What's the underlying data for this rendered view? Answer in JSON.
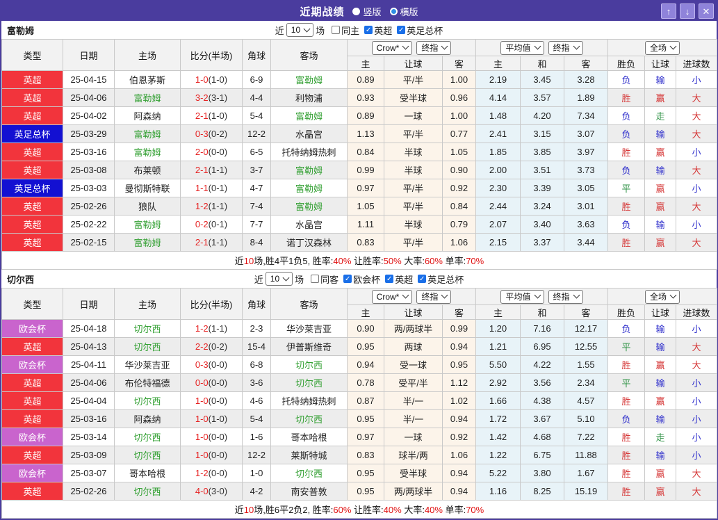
{
  "window": {
    "title": "近期战绩",
    "view_options": [
      {
        "label": "竖版",
        "selected": true
      },
      {
        "label": "横版",
        "selected": false
      }
    ],
    "buttons": [
      {
        "name": "scroll-up",
        "glyph": "↑"
      },
      {
        "name": "scroll-down",
        "glyph": "↓"
      },
      {
        "name": "close",
        "glyph": "✕"
      }
    ]
  },
  "league_colors": {
    "英超": "#f2343c",
    "英足总杯": "#1310d2",
    "欧会杯": "#c964cd"
  },
  "result_colors": {
    "胜": "#d53535",
    "赢": "#d53535",
    "大": "#d53535",
    "负": "#2d2dcb",
    "输": "#2d2dcb",
    "小": "#2d2dcb",
    "平": "#2e9245",
    "走": "#2e9245"
  },
  "table_header": {
    "main": [
      "类型",
      "日期",
      "主场",
      "比分(半场)",
      "角球",
      "客场"
    ],
    "odds_group": {
      "source": "Crow*",
      "index": "终指"
    },
    "avg_group": {
      "source": "平均值",
      "index": "终指"
    },
    "scope_group": {
      "label": "全场"
    },
    "sub": [
      "主",
      "让球",
      "客",
      "主",
      "和",
      "客",
      "胜负",
      "让球",
      "进球数"
    ]
  },
  "sections": [
    {
      "team": "富勒姆",
      "filters": {
        "prefix": "近",
        "count": "10",
        "suffix": "场",
        "checkboxes": [
          {
            "label": "同主",
            "checked": false
          },
          {
            "label": "英超",
            "checked": true
          },
          {
            "label": "英足总杯",
            "checked": true
          }
        ]
      },
      "rows": [
        {
          "league": "英超",
          "date": "25-04-15",
          "home": "伯恩茅斯",
          "score": "1-0",
          "half": "(1-0)",
          "corners": "6-9",
          "away": "富勒姆",
          "home_odds": "0.89",
          "handicap": "平/半",
          "away_odds": "1.00",
          "avg_home": "2.19",
          "avg_draw": "3.45",
          "avg_away": "3.28",
          "result": "负",
          "handicap_result": "输",
          "goals_result": "小"
        },
        {
          "league": "英超",
          "date": "25-04-06",
          "home": "富勒姆",
          "score": "3-2",
          "half": "(3-1)",
          "corners": "4-4",
          "away": "利物浦",
          "home_odds": "0.93",
          "handicap": "受半球",
          "away_odds": "0.96",
          "avg_home": "4.14",
          "avg_draw": "3.57",
          "avg_away": "1.89",
          "result": "胜",
          "handicap_result": "赢",
          "goals_result": "大"
        },
        {
          "league": "英超",
          "date": "25-04-02",
          "home": "阿森纳",
          "score": "2-1",
          "half": "(1-0)",
          "corners": "5-4",
          "away": "富勒姆",
          "home_odds": "0.89",
          "handicap": "一球",
          "away_odds": "1.00",
          "avg_home": "1.48",
          "avg_draw": "4.20",
          "avg_away": "7.34",
          "result": "负",
          "handicap_result": "走",
          "goals_result": "大"
        },
        {
          "league": "英足总杯",
          "date": "25-03-29",
          "home": "富勒姆",
          "score": "0-3",
          "half": "(0-2)",
          "corners": "12-2",
          "away": "水晶宫",
          "home_odds": "1.13",
          "handicap": "平/半",
          "away_odds": "0.77",
          "avg_home": "2.41",
          "avg_draw": "3.15",
          "avg_away": "3.07",
          "result": "负",
          "handicap_result": "输",
          "goals_result": "大"
        },
        {
          "league": "英超",
          "date": "25-03-16",
          "home": "富勒姆",
          "score": "2-0",
          "half": "(0-0)",
          "corners": "6-5",
          "away": "托特纳姆热刺",
          "home_odds": "0.84",
          "handicap": "半球",
          "away_odds": "1.05",
          "avg_home": "1.85",
          "avg_draw": "3.85",
          "avg_away": "3.97",
          "result": "胜",
          "handicap_result": "赢",
          "goals_result": "小"
        },
        {
          "league": "英超",
          "date": "25-03-08",
          "home": "布莱顿",
          "score": "2-1",
          "half": "(1-1)",
          "corners": "3-7",
          "away": "富勒姆",
          "home_odds": "0.99",
          "handicap": "半球",
          "away_odds": "0.90",
          "avg_home": "2.00",
          "avg_draw": "3.51",
          "avg_away": "3.73",
          "result": "负",
          "handicap_result": "输",
          "goals_result": "大"
        },
        {
          "league": "英足总杯",
          "date": "25-03-03",
          "home": "曼彻斯特联",
          "score": "1-1",
          "half": "(0-1)",
          "corners": "4-7",
          "away": "富勒姆",
          "home_odds": "0.97",
          "handicap": "平/半",
          "away_odds": "0.92",
          "avg_home": "2.30",
          "avg_draw": "3.39",
          "avg_away": "3.05",
          "result": "平",
          "handicap_result": "赢",
          "goals_result": "小"
        },
        {
          "league": "英超",
          "date": "25-02-26",
          "home": "狼队",
          "score": "1-2",
          "half": "(1-1)",
          "corners": "7-4",
          "away": "富勒姆",
          "home_odds": "1.05",
          "handicap": "平/半",
          "away_odds": "0.84",
          "avg_home": "2.44",
          "avg_draw": "3.24",
          "avg_away": "3.01",
          "result": "胜",
          "handicap_result": "赢",
          "goals_result": "大"
        },
        {
          "league": "英超",
          "date": "25-02-22",
          "home": "富勒姆",
          "score": "0-2",
          "half": "(0-1)",
          "corners": "7-7",
          "away": "水晶宫",
          "home_odds": "1.11",
          "handicap": "半球",
          "away_odds": "0.79",
          "avg_home": "2.07",
          "avg_draw": "3.40",
          "avg_away": "3.63",
          "result": "负",
          "handicap_result": "输",
          "goals_result": "小"
        },
        {
          "league": "英超",
          "date": "25-02-15",
          "home": "富勒姆",
          "score": "2-1",
          "half": "(1-1)",
          "corners": "8-4",
          "away": "诺丁汉森林",
          "home_odds": "0.83",
          "handicap": "平/半",
          "away_odds": "1.06",
          "avg_home": "2.15",
          "avg_draw": "3.37",
          "avg_away": "3.44",
          "result": "胜",
          "handicap_result": "赢",
          "goals_result": "大"
        }
      ],
      "summary": [
        {
          "text": "近"
        },
        {
          "text": "10",
          "red": true
        },
        {
          "text": "场,胜4平1负5, 胜率:"
        },
        {
          "text": "40%",
          "red": true
        },
        {
          "text": " 让胜率:"
        },
        {
          "text": "50%",
          "red": true
        },
        {
          "text": " 大率:"
        },
        {
          "text": "60%",
          "red": true
        },
        {
          "text": " 单率:"
        },
        {
          "text": "70%",
          "red": true
        }
      ]
    },
    {
      "team": "切尔西",
      "filters": {
        "prefix": "近",
        "count": "10",
        "suffix": "场",
        "checkboxes": [
          {
            "label": "同客",
            "checked": false
          },
          {
            "label": "欧会杯",
            "checked": true
          },
          {
            "label": "英超",
            "checked": true
          },
          {
            "label": "英足总杯",
            "checked": true
          }
        ]
      },
      "rows": [
        {
          "league": "欧会杯",
          "date": "25-04-18",
          "home": "切尔西",
          "score": "1-2",
          "half": "(1-1)",
          "corners": "2-3",
          "away": "华沙莱吉亚",
          "home_odds": "0.90",
          "handicap": "两/两球半",
          "away_odds": "0.99",
          "avg_home": "1.20",
          "avg_draw": "7.16",
          "avg_away": "12.17",
          "result": "负",
          "handicap_result": "输",
          "goals_result": "小"
        },
        {
          "league": "英超",
          "date": "25-04-13",
          "home": "切尔西",
          "score": "2-2",
          "half": "(0-2)",
          "corners": "15-4",
          "away": "伊普斯维奇",
          "home_odds": "0.95",
          "handicap": "两球",
          "away_odds": "0.94",
          "avg_home": "1.21",
          "avg_draw": "6.95",
          "avg_away": "12.55",
          "result": "平",
          "handicap_result": "输",
          "goals_result": "大"
        },
        {
          "league": "欧会杯",
          "date": "25-04-11",
          "home": "华沙莱吉亚",
          "score": "0-3",
          "half": "(0-0)",
          "corners": "6-8",
          "away": "切尔西",
          "home_odds": "0.94",
          "handicap": "受一球",
          "away_odds": "0.95",
          "avg_home": "5.50",
          "avg_draw": "4.22",
          "avg_away": "1.55",
          "result": "胜",
          "handicap_result": "赢",
          "goals_result": "大"
        },
        {
          "league": "英超",
          "date": "25-04-06",
          "home": "布伦特福德",
          "score": "0-0",
          "half": "(0-0)",
          "corners": "3-6",
          "away": "切尔西",
          "home_odds": "0.78",
          "handicap": "受平/半",
          "away_odds": "1.12",
          "avg_home": "2.92",
          "avg_draw": "3.56",
          "avg_away": "2.34",
          "result": "平",
          "handicap_result": "输",
          "goals_result": "小"
        },
        {
          "league": "英超",
          "date": "25-04-04",
          "home": "切尔西",
          "score": "1-0",
          "half": "(0-0)",
          "corners": "4-6",
          "away": "托特纳姆热刺",
          "home_odds": "0.87",
          "handicap": "半/一",
          "away_odds": "1.02",
          "avg_home": "1.66",
          "avg_draw": "4.38",
          "avg_away": "4.57",
          "result": "胜",
          "handicap_result": "赢",
          "goals_result": "小"
        },
        {
          "league": "英超",
          "date": "25-03-16",
          "home": "阿森纳",
          "score": "1-0",
          "half": "(1-0)",
          "corners": "5-4",
          "away": "切尔西",
          "home_odds": "0.95",
          "handicap": "半/一",
          "away_odds": "0.94",
          "avg_home": "1.72",
          "avg_draw": "3.67",
          "avg_away": "5.10",
          "result": "负",
          "handicap_result": "输",
          "goals_result": "小"
        },
        {
          "league": "欧会杯",
          "date": "25-03-14",
          "home": "切尔西",
          "score": "1-0",
          "half": "(0-0)",
          "corners": "1-6",
          "away": "哥本哈根",
          "home_odds": "0.97",
          "handicap": "一球",
          "away_odds": "0.92",
          "avg_home": "1.42",
          "avg_draw": "4.68",
          "avg_away": "7.22",
          "result": "胜",
          "handicap_result": "走",
          "goals_result": "小"
        },
        {
          "league": "英超",
          "date": "25-03-09",
          "home": "切尔西",
          "score": "1-0",
          "half": "(0-0)",
          "corners": "12-2",
          "away": "莱斯特城",
          "home_odds": "0.83",
          "handicap": "球半/两",
          "away_odds": "1.06",
          "avg_home": "1.22",
          "avg_draw": "6.75",
          "avg_away": "11.88",
          "result": "胜",
          "handicap_result": "输",
          "goals_result": "小"
        },
        {
          "league": "欧会杯",
          "date": "25-03-07",
          "home": "哥本哈根",
          "score": "1-2",
          "half": "(0-0)",
          "corners": "1-0",
          "away": "切尔西",
          "home_odds": "0.95",
          "handicap": "受半球",
          "away_odds": "0.94",
          "avg_home": "5.22",
          "avg_draw": "3.80",
          "avg_away": "1.67",
          "result": "胜",
          "handicap_result": "赢",
          "goals_result": "大"
        },
        {
          "league": "英超",
          "date": "25-02-26",
          "home": "切尔西",
          "score": "4-0",
          "half": "(3-0)",
          "corners": "4-2",
          "away": "南安普敦",
          "home_odds": "0.95",
          "handicap": "两/两球半",
          "away_odds": "0.94",
          "avg_home": "1.16",
          "avg_draw": "8.25",
          "avg_away": "15.19",
          "result": "胜",
          "handicap_result": "赢",
          "goals_result": "大"
        }
      ],
      "summary": [
        {
          "text": "近"
        },
        {
          "text": "10",
          "red": true
        },
        {
          "text": "场,胜6平2负2, 胜率:"
        },
        {
          "text": "60%",
          "red": true
        },
        {
          "text": " 让胜率:"
        },
        {
          "text": "40%",
          "red": true
        },
        {
          "text": " 大率:"
        },
        {
          "text": "40%",
          "red": true
        },
        {
          "text": " 单率:"
        },
        {
          "text": "70%",
          "red": true
        }
      ]
    }
  ]
}
